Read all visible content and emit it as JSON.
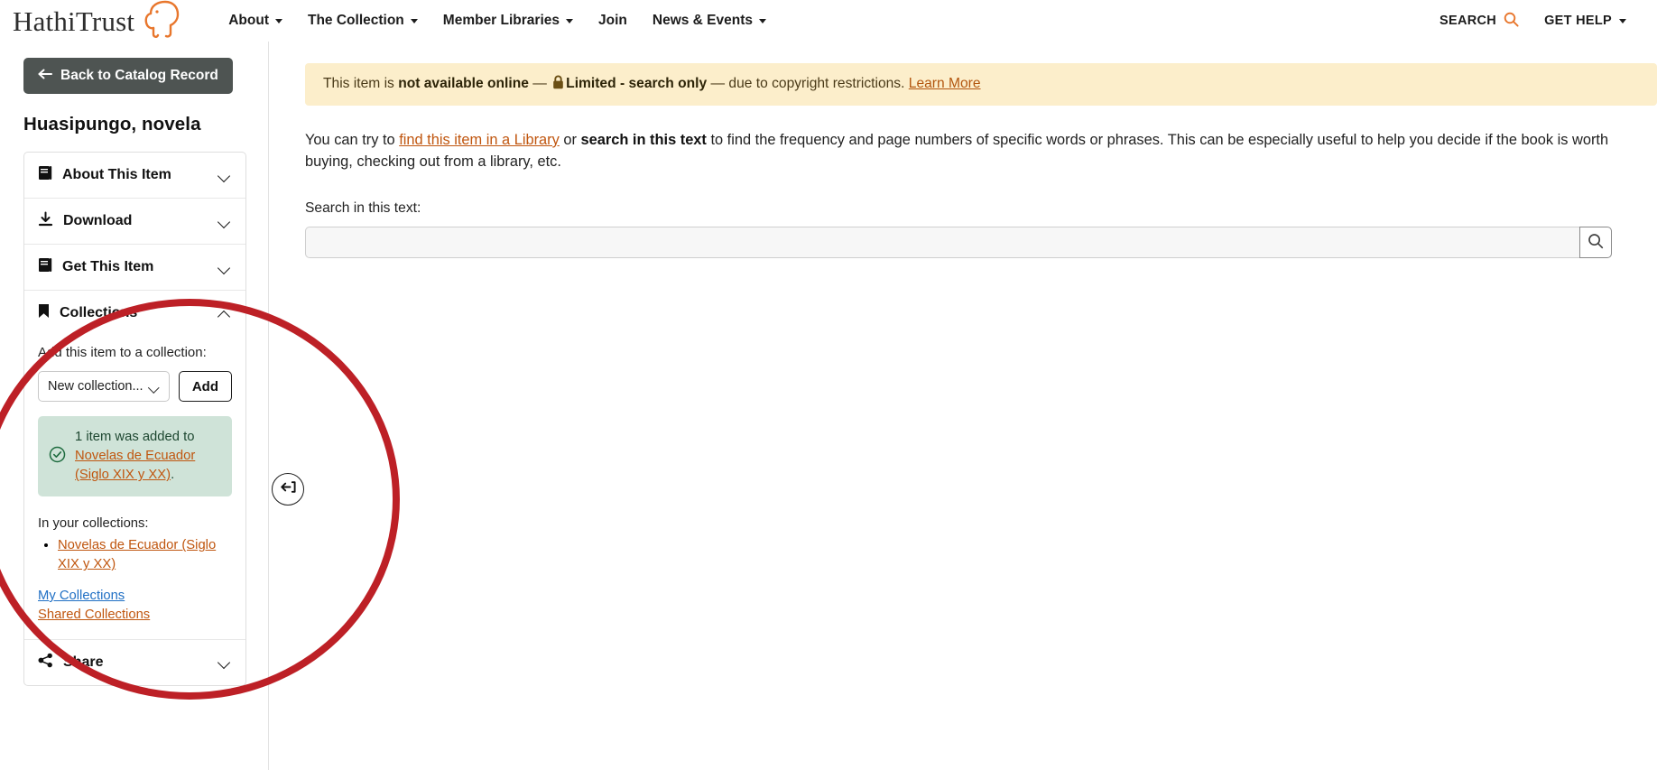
{
  "header": {
    "logo_text": "HathiTrust",
    "logo_icon": "elephant-logo-icon",
    "nav": [
      {
        "label": "About",
        "has_caret": true
      },
      {
        "label": "The Collection",
        "has_caret": true
      },
      {
        "label": "Member Libraries",
        "has_caret": true
      },
      {
        "label": "Join",
        "has_caret": false
      },
      {
        "label": "News & Events",
        "has_caret": true
      }
    ],
    "search_label": "SEARCH",
    "search_icon": "search-icon",
    "get_help_label": "GET HELP",
    "get_help_caret": "chevron-down-icon"
  },
  "sidebar": {
    "back_button": "Back to Catalog Record",
    "back_arrow_icon": "arrow-left-icon",
    "item_title": "Huasipungo, novela",
    "sections": [
      {
        "label": "About This Item",
        "icon": "book-icon",
        "state": "collapsed"
      },
      {
        "label": "Download",
        "icon": "download-icon",
        "state": "collapsed"
      },
      {
        "label": "Get This Item",
        "icon": "book-icon",
        "state": "collapsed"
      },
      {
        "label": "Collections",
        "icon": "bookmark-icon",
        "state": "expanded"
      },
      {
        "label": "Share",
        "icon": "share-icon",
        "state": "collapsed"
      }
    ],
    "collections": {
      "add_label": "Add this item to a collection:",
      "select_value": "New collection...",
      "select_options": [
        "New collection..."
      ],
      "add_button": "Add",
      "success_prefix": "1 item was added to",
      "success_link": "Novelas de Ecuador (Siglo XIX y XX)",
      "success_suffix": ".",
      "success_icon": "check-circle-icon",
      "in_your_collections_label": "In your collections:",
      "items": [
        "Novelas de Ecuador (Siglo XIX y XX)"
      ],
      "my_collections_link": "My Collections",
      "shared_collections_link": "Shared Collections"
    },
    "collapse_handle_icon": "collapse-sidebar-icon"
  },
  "main": {
    "notice": {
      "text_1": "This item is ",
      "bold_1": "not available online",
      "dash_1": " — ",
      "lock_icon": "lock-icon",
      "bold_2": "Limited - search only",
      "dash_2": " — ",
      "text_2": "due to copyright restrictions. ",
      "link": "Learn More"
    },
    "intro": {
      "t1": "You can try to ",
      "link": "find this item in a Library",
      "t2": " or ",
      "bold": "search in this text",
      "t3": " to find the frequency and page numbers of specific words or phrases. This can be especially useful to help you decide if the book is worth buying, checking out from a library, etc."
    },
    "search": {
      "label": "Search in this text:",
      "value": "",
      "placeholder": "",
      "button_icon": "search-icon"
    }
  },
  "annotation": {
    "shape": "ellipse",
    "color": "#bd2026",
    "target": "collections-section"
  },
  "colors": {
    "brand_orange": "#c0560f",
    "notice_bg": "#fceecb",
    "success_bg": "#cfe3d8",
    "back_button_bg": "#4e5452",
    "link_blue": "#1f6fc4",
    "annotation_red": "#bd2026"
  }
}
